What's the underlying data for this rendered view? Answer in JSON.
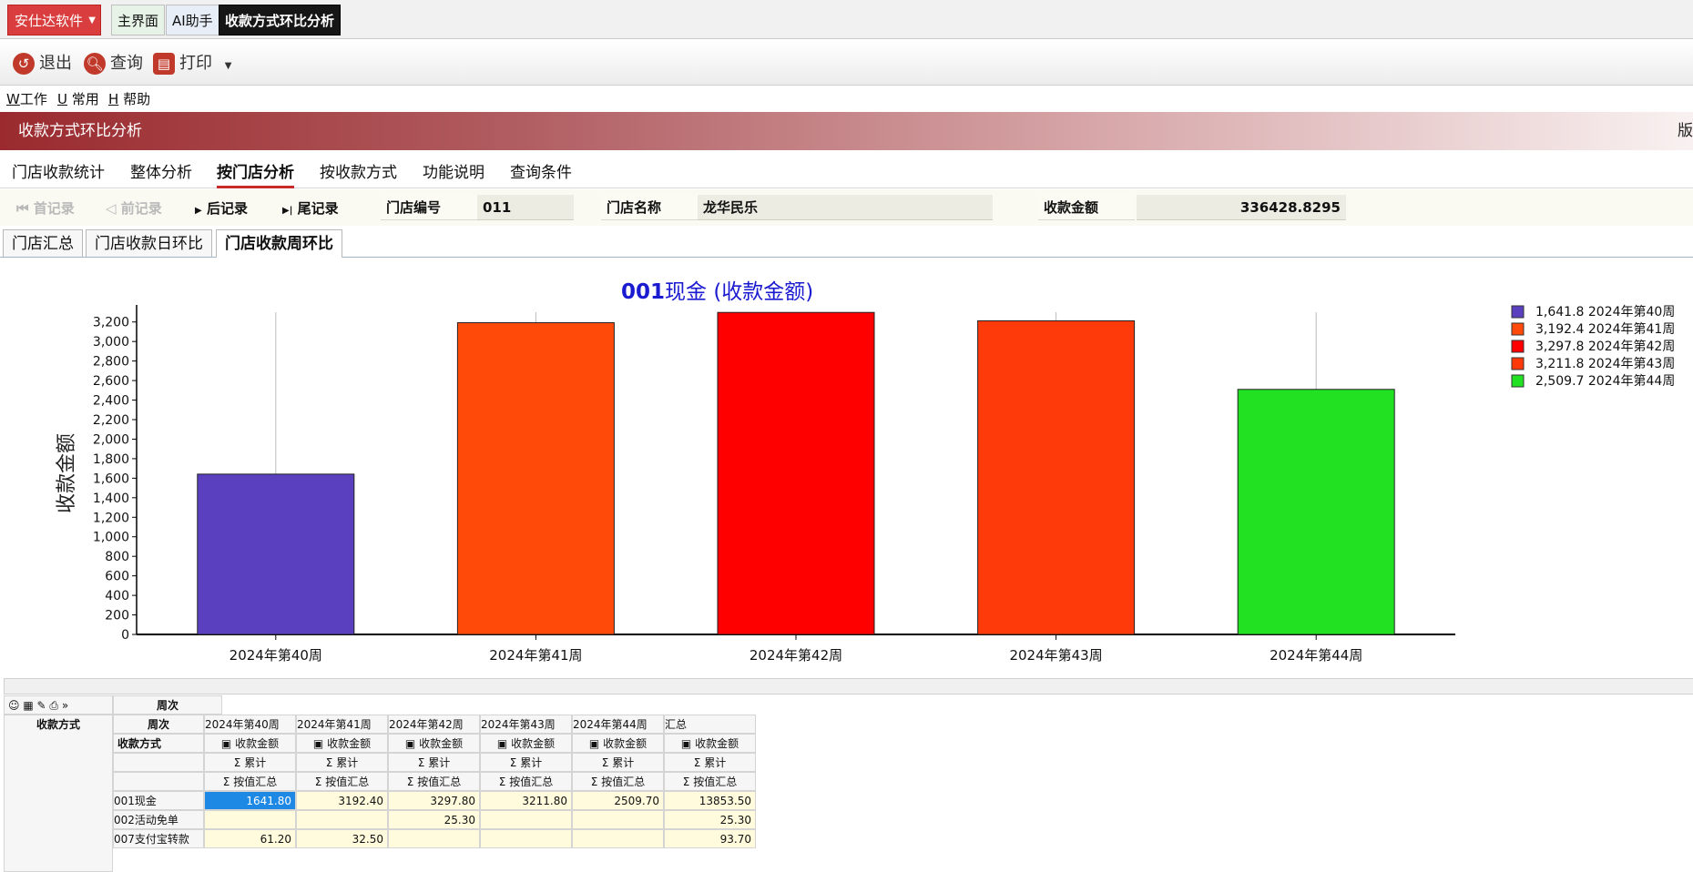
{
  "topbar": {
    "brand": "安仕达软件",
    "tabs": [
      "主界面",
      "AI助手",
      "收款方式环比分析"
    ]
  },
  "toolbar": {
    "exit": "退出",
    "query": "查询",
    "print": "打印"
  },
  "menu": [
    {
      "key": "W",
      "label": "工作"
    },
    {
      "key": "U",
      "label": "常用"
    },
    {
      "key": "H",
      "label": "帮助"
    }
  ],
  "banner": {
    "title": "收款方式环比分析",
    "right": "版"
  },
  "navtabs": [
    "门店收款统计",
    "整体分析",
    "按门店分析",
    "按收款方式",
    "功能说明",
    "查询条件"
  ],
  "record": {
    "first": "首记录",
    "prev": "前记录",
    "next": "后记录",
    "last": "尾记录",
    "store_no_label": "门店编号",
    "store_no": "011",
    "store_name_label": "门店名称",
    "store_name": "龙华民乐",
    "amount_label": "收款金额",
    "amount": "336428.8295"
  },
  "subtabs": [
    "门店汇总",
    "门店收款日环比",
    "门店收款周环比"
  ],
  "colors": {
    "brand": "#d93d3d",
    "banner": "#9a2a2e",
    "active_tab": "#c82a2a"
  },
  "chart_data": {
    "type": "bar",
    "title_code": "001",
    "title_rest": "现金 (收款金额)",
    "ylabel": "收款金额",
    "categories": [
      "2024年第40周",
      "2024年第41周",
      "2024年第42周",
      "2024年第43周",
      "2024年第44周"
    ],
    "values": [
      1641.8,
      3192.4,
      3297.8,
      3211.8,
      2509.7
    ],
    "colors": [
      "#5a40bf",
      "#ff4a0a",
      "#ff0000",
      "#ff3a0a",
      "#22e022"
    ],
    "legend": [
      "1,641.8  2024年第40周",
      "3,192.4  2024年第41周",
      "3,297.8  2024年第42周",
      "3,211.8  2024年第43周",
      "2,509.7  2024年第44周"
    ],
    "legend_position": "top-right",
    "ylim": [
      0,
      3300
    ],
    "yticks": [
      "0",
      "200",
      "400",
      "600",
      "800",
      "1,000",
      "1,200",
      "1,400",
      "1,600",
      "1,800",
      "2,000",
      "2,200",
      "2,400",
      "2,600",
      "2,800",
      "3,000",
      "3,200"
    ]
  },
  "grid": {
    "top_field": "周次",
    "row_field": "收款方式",
    "col_field": "周次",
    "sub_label": "收款方式",
    "weeks": [
      "2024年第40周",
      "2024年第41周",
      "2024年第42周",
      "2024年第43周",
      "2024年第44周",
      "汇总"
    ],
    "measure": "收款金额",
    "agg": "Σ  累计",
    "agg2": "Σ  按值汇总",
    "rows": [
      {
        "name": "001现金",
        "values": [
          "1641.80",
          "3192.40",
          "3297.80",
          "3211.80",
          "2509.70",
          "13853.50"
        ]
      },
      {
        "name": "002活动免单",
        "values": [
          "",
          "",
          "25.30",
          "",
          "",
          "25.30"
        ]
      },
      {
        "name": "007支付宝转款",
        "values": [
          "61.20",
          "32.50",
          "",
          "",
          "",
          "93.70"
        ]
      }
    ]
  }
}
